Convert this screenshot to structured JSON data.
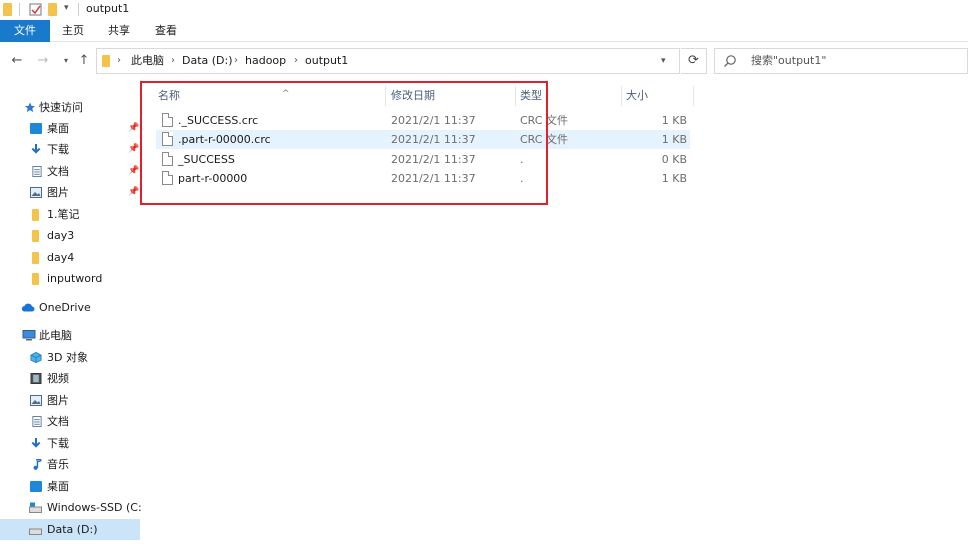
{
  "window": {
    "title": "output1"
  },
  "ribbon": {
    "tabs": [
      {
        "label": "文件"
      },
      {
        "label": "主页"
      },
      {
        "label": "共享"
      },
      {
        "label": "查看"
      }
    ]
  },
  "address": {
    "segments": [
      "此电脑",
      "Data (D:)",
      "hadoop",
      "output1"
    ]
  },
  "search": {
    "placeholder": "搜索\"output1\""
  },
  "sidebar": {
    "quick_access": "快速访问",
    "quick_items": [
      {
        "label": "桌面",
        "icon": "desktop-icon",
        "pinned": true
      },
      {
        "label": "下载",
        "icon": "download-icon",
        "pinned": true
      },
      {
        "label": "文档",
        "icon": "documents-icon",
        "pinned": true
      },
      {
        "label": "图片",
        "icon": "pictures-icon",
        "pinned": true
      },
      {
        "label": "1.笔记",
        "icon": "folder-icon",
        "pinned": false
      },
      {
        "label": "day3",
        "icon": "folder-icon",
        "pinned": false
      },
      {
        "label": "day4",
        "icon": "folder-icon",
        "pinned": false
      },
      {
        "label": "inputword",
        "icon": "folder-icon",
        "pinned": false
      }
    ],
    "onedrive": "OneDrive",
    "this_pc": "此电脑",
    "pc_items": [
      {
        "label": "3D 对象",
        "icon": "3d-objects-icon"
      },
      {
        "label": "视频",
        "icon": "videos-icon"
      },
      {
        "label": "图片",
        "icon": "pictures-icon"
      },
      {
        "label": "文档",
        "icon": "documents-icon"
      },
      {
        "label": "下载",
        "icon": "download-icon"
      },
      {
        "label": "音乐",
        "icon": "music-icon"
      },
      {
        "label": "桌面",
        "icon": "desktop-icon"
      },
      {
        "label": "Windows-SSD (C:)",
        "icon": "drive-icon"
      },
      {
        "label": "Data (D:)",
        "icon": "drive-icon",
        "selected": true
      }
    ]
  },
  "columns": {
    "name": "名称",
    "modified": "修改日期",
    "type": "类型",
    "size": "大小"
  },
  "files": [
    {
      "name": "._SUCCESS.crc",
      "modified": "2021/2/1 11:37",
      "type": "CRC 文件",
      "size": "1 KB",
      "highlighted": false
    },
    {
      "name": ".part-r-00000.crc",
      "modified": "2021/2/1 11:37",
      "type": "CRC 文件",
      "size": "1 KB",
      "highlighted": true
    },
    {
      "name": "_SUCCESS",
      "modified": "2021/2/1 11:37",
      "type": ".",
      "size": "0 KB",
      "highlighted": false
    },
    {
      "name": "part-r-00000",
      "modified": "2021/2/1 11:37",
      "type": ".",
      "size": "1 KB",
      "highlighted": false
    }
  ],
  "colors": {
    "accent": "#1979ca",
    "selection": "#cce4f7",
    "highlight_row": "#e5f3ff",
    "annotation_box": "#e0202a"
  }
}
